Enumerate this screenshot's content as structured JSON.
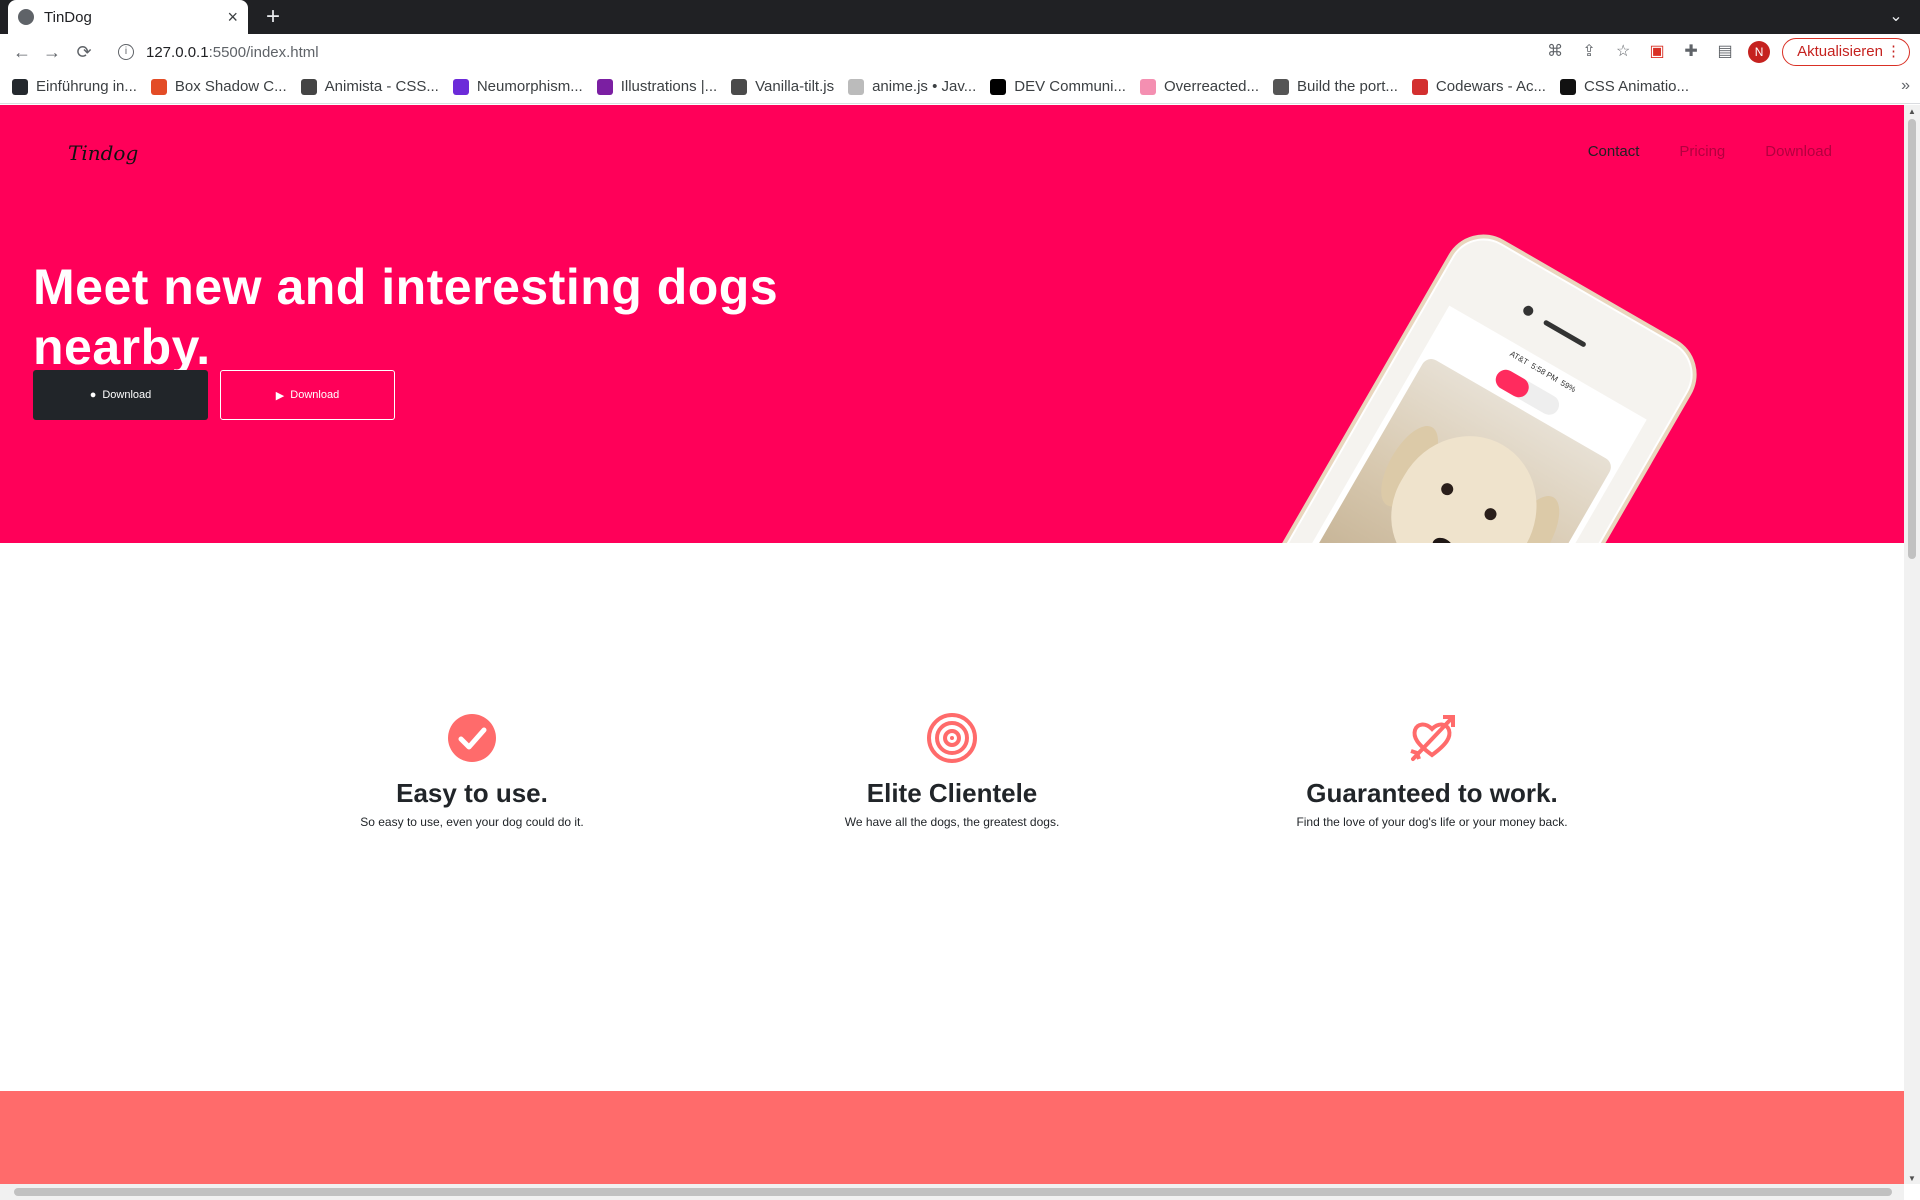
{
  "browser": {
    "tab_title": "TinDog",
    "url_host": "127.0.0.1",
    "url_rest": ":5500/index.html",
    "update_label": "Aktualisieren",
    "profile_initial": "N",
    "bookmarks": [
      "Einführung in...",
      "Box Shadow C...",
      "Animista - CSS...",
      "Neumorphism...",
      "Illustrations |...",
      "Vanilla-tilt.js",
      "anime.js • Jav...",
      "DEV Communi...",
      "Overreacted...",
      "Build the port...",
      "Codewars - Ac...",
      "CSS Animatio..."
    ]
  },
  "colors": {
    "hero_bg": "#ff0059",
    "accent_icon": "#ff6b6b",
    "dark_btn": "#212529",
    "bottom_band": "#ff6b6b"
  },
  "page": {
    "brand": "Tindog",
    "nav": [
      "Contact",
      "Pricing",
      "Download"
    ],
    "headline": "Meet new and interesting dogs nearby.",
    "buttons": [
      "Download",
      "Download"
    ]
  },
  "phone": {
    "carrier": "AT&T",
    "time": "5:58 PM",
    "battery": "59%"
  },
  "features": [
    {
      "icon": "check-circle-icon",
      "title": "Easy to use.",
      "text": "So easy to use, even your dog could do it."
    },
    {
      "icon": "bullseye-icon",
      "title": "Elite Clientele",
      "text": "We have all the dogs, the greatest dogs."
    },
    {
      "icon": "heart-arrow-icon",
      "title": "Guaranteed to work.",
      "text": "Find the love of your dog's life or your money back."
    }
  ]
}
